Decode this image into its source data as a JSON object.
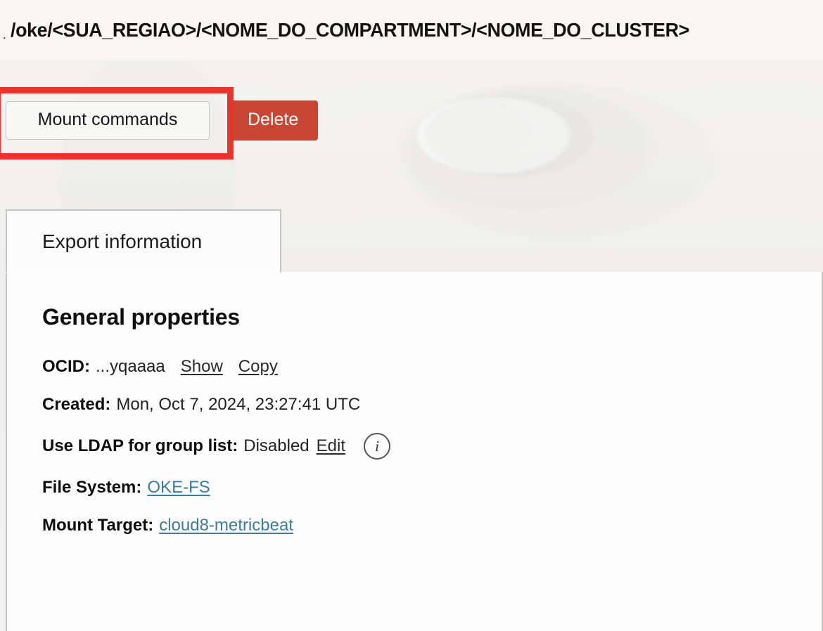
{
  "path_bar": {
    "lead_glyph": ".",
    "path": "/oke/<SUA_REGIAO>/<NOME_DO_COMPARTMENT>/<NOME_DO_CLUSTER>"
  },
  "actions": {
    "mount_commands_label": "Mount commands",
    "delete_label": "Delete",
    "highlight_color": "#e8352a",
    "delete_color": "#c74634"
  },
  "tabs": [
    {
      "label": "Export information",
      "active": true
    }
  ],
  "panel": {
    "heading": "General properties",
    "properties": [
      {
        "label": "OCID:",
        "value": "...yqaaaa",
        "show_label": "Show",
        "copy_label": "Copy"
      },
      {
        "label": "Created:",
        "value": "Mon, Oct 7, 2024, 23:27:41 UTC"
      },
      {
        "label": "Use LDAP for group list:",
        "value": "Disabled",
        "edit_label": "Edit",
        "info_glyph": "i"
      },
      {
        "label": "File System:",
        "link": "OKE-FS"
      },
      {
        "label": "Mount Target:",
        "link": "cloud8-metricbeat"
      }
    ],
    "link_color": "#3c7d9e"
  }
}
